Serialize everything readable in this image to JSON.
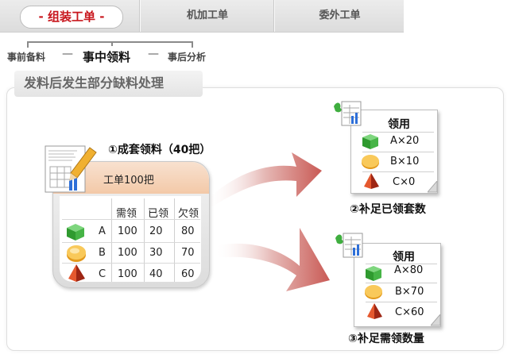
{
  "tabs": [
    {
      "label": "- 组装工单 -",
      "active": true
    },
    {
      "label": "机加工单",
      "active": false
    },
    {
      "label": "委外工单",
      "active": false
    }
  ],
  "steps": {
    "before": "事前备料",
    "current": "事中领料",
    "after": "事后分析",
    "dash": "—"
  },
  "section_title": "发料后发生部分缺料处理",
  "order": {
    "lead_label": "①成套领料（40把）",
    "title": "工单100把",
    "columns": [
      "需领",
      "已领",
      "欠领"
    ],
    "rows": [
      {
        "item": "A",
        "shape": "green-cube-icon",
        "need": "100",
        "taken": "20",
        "owed": "80"
      },
      {
        "item": "B",
        "shape": "gold-coin-icon",
        "need": "100",
        "taken": "30",
        "owed": "70"
      },
      {
        "item": "C",
        "shape": "red-pyramid-icon",
        "need": "100",
        "taken": "40",
        "owed": "60"
      }
    ]
  },
  "doc_top": {
    "title": "领用",
    "rows": [
      "A×20",
      "B×10",
      "C×0"
    ],
    "caption": "②补足已领套数"
  },
  "doc_bottom": {
    "title": "领用",
    "rows": [
      "A×80",
      "B×70",
      "C×60"
    ],
    "caption": "③补足需领数量"
  },
  "colors": {
    "accent": "#c8161d",
    "cube": "#3aa63a",
    "coin": "#f2b12e",
    "pyramid": "#c0391b"
  }
}
